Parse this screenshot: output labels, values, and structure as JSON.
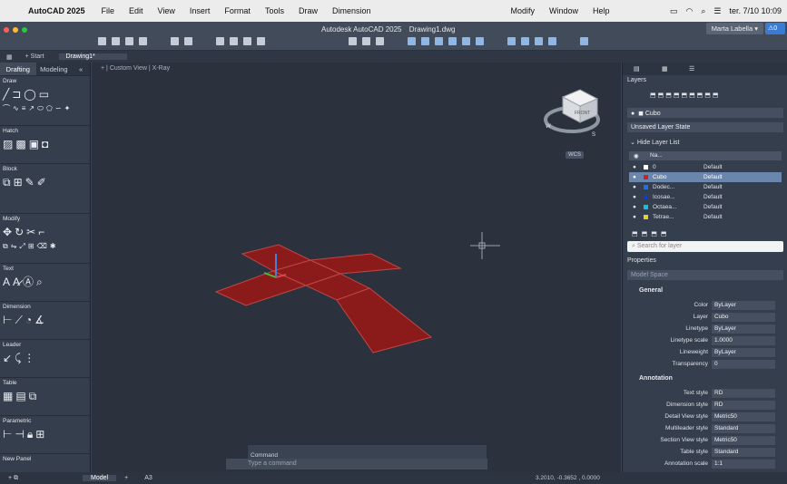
{
  "menubar": {
    "app_name": "AutoCAD 2025",
    "items": [
      "File",
      "Edit",
      "View",
      "Insert",
      "Format",
      "Tools",
      "Draw",
      "Dimension"
    ],
    "right_items": [
      "Modify",
      "Window",
      "Help"
    ],
    "clock": "ter. 7/10  10:09"
  },
  "window": {
    "app_title": "Autodesk AutoCAD 2025",
    "doc_title": "Drawing1.dwg",
    "user": "Marta Labella"
  },
  "tabs": {
    "start": "Start",
    "active": "Drawing1*"
  },
  "palette": {
    "tabs": [
      "Drafting",
      "Modeling"
    ],
    "sections": [
      "Draw",
      "Hatch",
      "Block",
      "Modify",
      "Text",
      "Dimension",
      "Leader",
      "Table",
      "Parametric",
      "New Panel"
    ]
  },
  "viewport": {
    "label1": "Custom View",
    "label2": "X-Ray",
    "wcs": "WCS",
    "viewcube_face": "FRONT"
  },
  "command": {
    "history": "Command",
    "placeholder": "Type a command"
  },
  "layers": {
    "title": "Layers",
    "current_layer": "Cubo",
    "layer_state": "Unsaved Layer State",
    "hide_list": "Hide Layer List",
    "col_name": "Na...",
    "rows": [
      {
        "name": "0",
        "linetype": "Default",
        "color": "#ffffff",
        "selected": false
      },
      {
        "name": "Cubo",
        "linetype": "Default",
        "color": "#d02020",
        "selected": true
      },
      {
        "name": "Dodec...",
        "linetype": "Default",
        "color": "#2a6fd6",
        "selected": false
      },
      {
        "name": "Icosae...",
        "linetype": "Default",
        "color": "#1838c8",
        "selected": false
      },
      {
        "name": "Octaea...",
        "linetype": "Default",
        "color": "#28b8d8",
        "selected": false
      },
      {
        "name": "Tetrae...",
        "linetype": "Default",
        "color": "#e8d020",
        "selected": false
      }
    ],
    "search_placeholder": "Search for layer"
  },
  "properties": {
    "title": "Properties",
    "context": "Model Space",
    "general_label": "General",
    "annotation_label": "Annotation",
    "general": [
      {
        "k": "Color",
        "v": "ByLayer"
      },
      {
        "k": "Layer",
        "v": "Cubo"
      },
      {
        "k": "Linetype",
        "v": "ByLayer"
      },
      {
        "k": "Linetype scale",
        "v": "1.0000"
      },
      {
        "k": "Lineweight",
        "v": "ByLayer"
      },
      {
        "k": "Transparency",
        "v": "0"
      }
    ],
    "annotation": [
      {
        "k": "Text style",
        "v": "RD"
      },
      {
        "k": "Dimension style",
        "v": "RD"
      },
      {
        "k": "Detail View style",
        "v": "Metric50"
      },
      {
        "k": "Multileader style",
        "v": "Standard"
      },
      {
        "k": "Section View style",
        "v": "Metric50"
      },
      {
        "k": "Table style",
        "v": "Standard"
      },
      {
        "k": "Annotation scale",
        "v": "1:1"
      }
    ]
  },
  "status": {
    "model": "Model",
    "layout": "A3",
    "coords": "3.2010, -0.3652 , 0.0000"
  },
  "colors": {
    "accent": "#3a7bd5",
    "net_fill": "#8b1a1a",
    "net_edge": "#c24646"
  }
}
